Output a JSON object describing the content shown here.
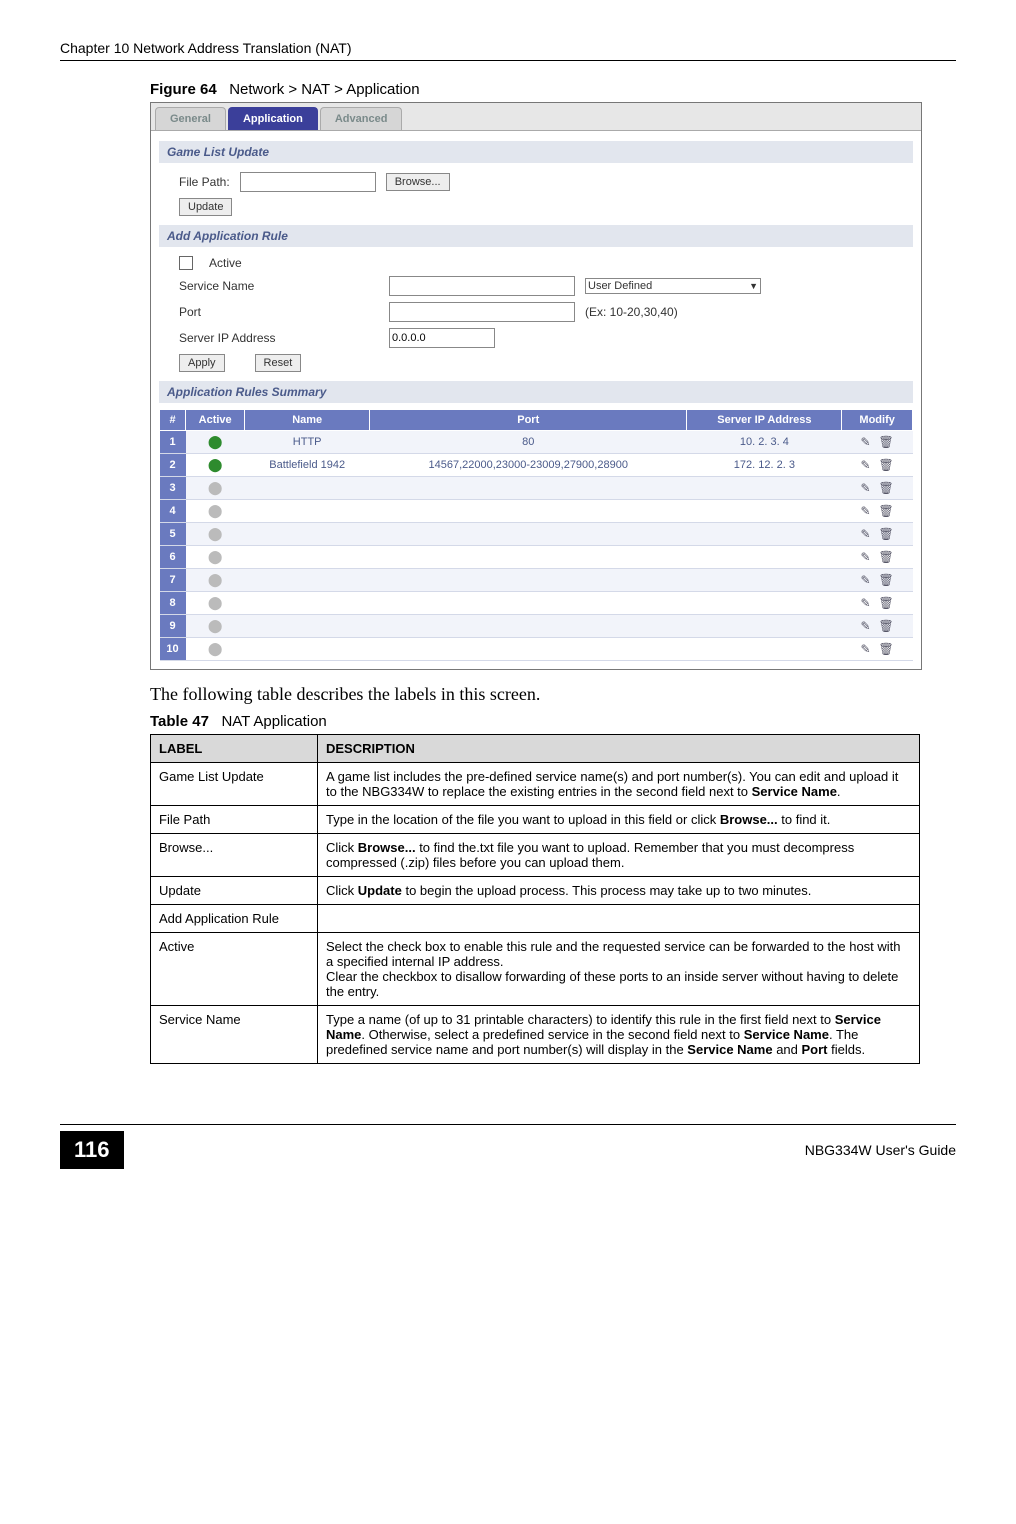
{
  "chapter_header": "Chapter 10 Network Address Translation (NAT)",
  "figure": {
    "label": "Figure 64",
    "caption": "Network > NAT > Application"
  },
  "screenshot": {
    "tabs": {
      "general": "General",
      "application": "Application",
      "advanced": "Advanced"
    },
    "section_game_list": "Game List Update",
    "file_path_label": "File Path:",
    "browse_btn": "Browse...",
    "update_btn": "Update",
    "section_add_rule": "Add Application Rule",
    "active_label": "Active",
    "service_name_label": "Service Name",
    "service_dropdown": "User Defined",
    "port_label": "Port",
    "port_hint": "(Ex: 10-20,30,40)",
    "server_ip_label": "Server IP Address",
    "server_ip_value": "0.0.0.0",
    "apply_btn": "Apply",
    "reset_btn": "Reset",
    "section_summary": "Application Rules Summary",
    "headers": {
      "num": "#",
      "active": "Active",
      "name": "Name",
      "port": "Port",
      "server_ip": "Server IP Address",
      "modify": "Modify"
    },
    "rows": [
      {
        "num": "1",
        "active": true,
        "name": "HTTP",
        "port": "80",
        "ip": "10. 2. 3. 4"
      },
      {
        "num": "2",
        "active": true,
        "name": "Battlefield 1942",
        "port": "14567,22000,23000-23009,27900,28900",
        "ip": "172. 12. 2. 3"
      },
      {
        "num": "3",
        "active": false,
        "name": "",
        "port": "",
        "ip": ""
      },
      {
        "num": "4",
        "active": false,
        "name": "",
        "port": "",
        "ip": ""
      },
      {
        "num": "5",
        "active": false,
        "name": "",
        "port": "",
        "ip": ""
      },
      {
        "num": "6",
        "active": false,
        "name": "",
        "port": "",
        "ip": ""
      },
      {
        "num": "7",
        "active": false,
        "name": "",
        "port": "",
        "ip": ""
      },
      {
        "num": "8",
        "active": false,
        "name": "",
        "port": "",
        "ip": ""
      },
      {
        "num": "9",
        "active": false,
        "name": "",
        "port": "",
        "ip": ""
      },
      {
        "num": "10",
        "active": false,
        "name": "",
        "port": "",
        "ip": ""
      }
    ]
  },
  "body_text": "The following table describes the labels in this screen.",
  "table_caption": {
    "label": "Table 47",
    "caption": "NAT Application"
  },
  "desc_table": {
    "header_label": "LABEL",
    "header_desc": "DESCRIPTION",
    "rows": [
      {
        "label": "Game List Update",
        "desc_parts": [
          "A game list includes the pre-defined service name(s) and port number(s). You can edit and upload it to the NBG334W to replace the existing entries in the second field next to ",
          "Service Name",
          "."
        ]
      },
      {
        "label": "File Path",
        "desc_parts": [
          "Type in the location of the file you want to upload in this field or click ",
          "Browse...",
          " to find it."
        ]
      },
      {
        "label": "Browse...",
        "desc_parts": [
          "Click ",
          "Browse...",
          " to find the.txt file you want to upload. Remember that you must decompress compressed (.zip) files before you can upload them."
        ]
      },
      {
        "label": "Update",
        "desc_parts": [
          "Click ",
          "Update",
          " to begin the upload process. This process may take up to two minutes."
        ]
      },
      {
        "label": "Add Application Rule",
        "desc_parts": [
          ""
        ]
      },
      {
        "label": "Active",
        "desc_parts": [
          "Select the check box to enable this rule and the requested service can be forwarded to the host with a specified internal IP address.\nClear the checkbox to disallow forwarding of these ports to an inside server without having to delete the entry."
        ]
      },
      {
        "label": "Service Name",
        "desc_parts": [
          "Type a name (of up to 31 printable characters) to identify this rule in the first field next to ",
          "Service Name",
          ". Otherwise, select a predefined service in the second field next to ",
          "Service Name",
          ". The predefined service name and port number(s) will display in the ",
          "Service Name",
          " and ",
          "Port",
          " fields."
        ]
      }
    ]
  },
  "footer": {
    "page": "116",
    "guide": "NBG334W User's Guide"
  }
}
